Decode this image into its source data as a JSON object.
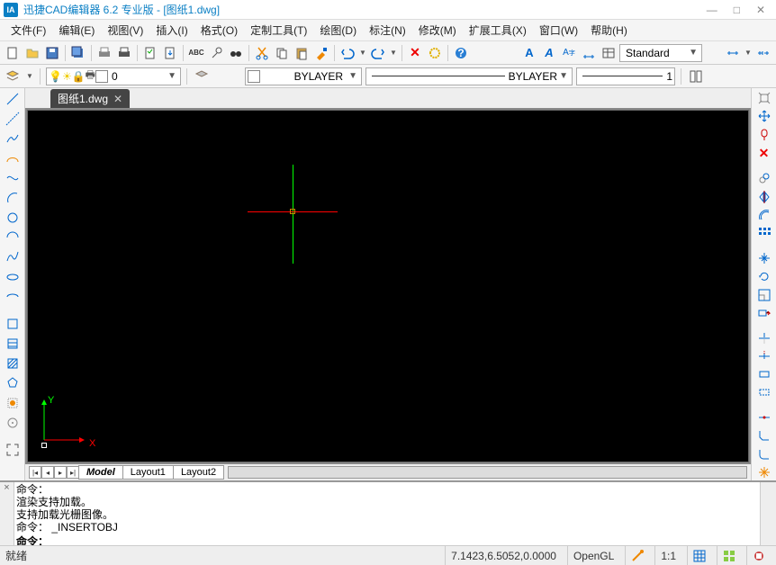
{
  "window": {
    "title": "迅捷CAD编辑器 6.2 专业版  - [图纸1.dwg]",
    "min": "—",
    "max": "□",
    "close": "✕"
  },
  "menu": [
    {
      "l": "文件",
      "h": "(F)"
    },
    {
      "l": "编辑",
      "h": "(E)"
    },
    {
      "l": "视图",
      "h": "(V)"
    },
    {
      "l": "插入",
      "h": "(I)"
    },
    {
      "l": "格式",
      "h": "(O)"
    },
    {
      "l": "定制工具",
      "h": "(T)"
    },
    {
      "l": "绘图",
      "h": "(D)"
    },
    {
      "l": "标注",
      "h": "(N)"
    },
    {
      "l": "修改",
      "h": "(M)"
    },
    {
      "l": "扩展工具",
      "h": "(X)"
    },
    {
      "l": "窗口",
      "h": "(W)"
    },
    {
      "l": "帮助",
      "h": "(H)"
    }
  ],
  "toolbar1": {
    "style_label": "Standard"
  },
  "toolbar2": {
    "layer": "0",
    "bylayer1": "BYLAYER",
    "bylayer2": "BYLAYER",
    "lineweight": "1"
  },
  "doctab": {
    "label": "图纸1.dwg",
    "close": "✕"
  },
  "ucs": {
    "x": "X",
    "y": "Y"
  },
  "model_tabs": {
    "nav": [
      "|◂",
      "◂",
      "▸",
      "▸|"
    ],
    "tabs": [
      "Model",
      "Layout1",
      "Layout2"
    ]
  },
  "cmd": {
    "lines": [
      "命令：",
      "渲染支持加载。",
      "支持加载光栅图像。",
      "命令：  _INSERTOBJ"
    ],
    "prompt": "命令："
  },
  "status": {
    "ready": "就绪",
    "coords": "7.1423,6.5052,0.0000",
    "renderer": "OpenGL",
    "scale": "1:1"
  }
}
